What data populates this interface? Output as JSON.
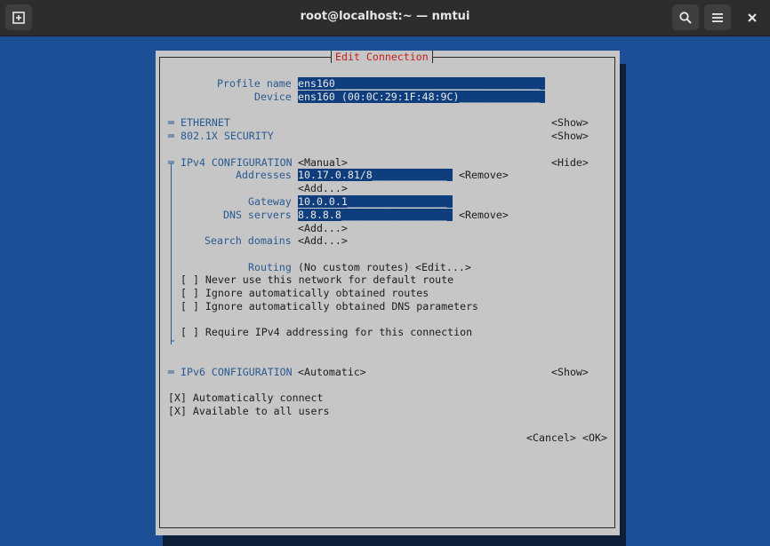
{
  "window": {
    "title": "root@localhost:~ — nmtui",
    "new_tab_glyph": "+",
    "close_glyph": "✕"
  },
  "dialog": {
    "title": "Edit Connection",
    "profile_name_label": "Profile name",
    "profile_name_value": "ens160_________________________________",
    "device_label": "Device",
    "device_value": "ens160 (00:0C:29:1F:48:9C)_____________",
    "ethernet": {
      "marker": "═",
      "label": "ETHERNET",
      "toggle": "<Show>"
    },
    "security": {
      "marker": "═",
      "label": "802.1X SECURITY",
      "toggle": "<Show>"
    },
    "ipv4": {
      "marker": "╤",
      "label": "IPv4 CONFIGURATION",
      "mode": "<Manual>",
      "toggle": "<Hide>",
      "addresses_label": "Addresses",
      "address_value": "10.17.0.81/8____________",
      "address_remove": "<Remove>",
      "address_add": "<Add...>",
      "gateway_label": "Gateway",
      "gateway_value": "10.0.0.1________________",
      "dns_label": "DNS servers",
      "dns_value": "8.8.8.8_________________",
      "dns_remove": "<Remove>",
      "dns_add": "<Add...>",
      "search_label": "Search domains",
      "search_add": "<Add...>",
      "routing_label": "Routing",
      "routing_value": "(No custom routes)",
      "routing_edit": "<Edit...>",
      "options": [
        "[ ] Never use this network for default route",
        "[ ] Ignore automatically obtained routes",
        "[ ] Ignore automatically obtained DNS parameters"
      ],
      "require": "[ ] Require IPv4 addressing for this connection",
      "end_marker": "└"
    },
    "ipv6": {
      "marker": "═",
      "label": "IPv6 CONFIGURATION",
      "mode": "<Automatic>",
      "toggle": "<Show>"
    },
    "auto_connect": "[X] Automatically connect",
    "all_users": "[X] Available to all users",
    "cancel": "<Cancel>",
    "ok": "<OK>"
  }
}
